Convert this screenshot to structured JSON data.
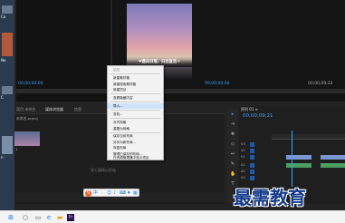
{
  "desktop": {
    "items": [
      {
        "label": "Ca"
      },
      {
        "label": "Ne"
      },
      {
        "label": "C"
      },
      {
        "label": "n"
      }
    ]
  },
  "source_monitor": {
    "timecode": "00;00;00;00"
  },
  "program_monitor": {
    "video_caption": "❤遇向日落，日出复活☀",
    "timecode": "00;00;00;00",
    "duration": "00;00;09;22"
  },
  "project_panel": {
    "tabs": [
      {
        "label": "项目 未命名"
      },
      {
        "label": "媒体浏览器"
      },
      {
        "label": "信息"
      }
    ],
    "search_row": "未命名.prproj",
    "thumb_label": "1",
    "import_hint": "导入媒体以开始"
  },
  "timeline": {
    "title": "序列 01 ≡",
    "timecode": "00;00;09;21",
    "tracks": [
      {
        "label": "V3"
      },
      {
        "label": "V2"
      },
      {
        "label": "V1"
      },
      {
        "label": "A1"
      },
      {
        "label": "A2"
      },
      {
        "label": "A3"
      }
    ],
    "clip_label": "fx 01.mp4"
  },
  "context_menu": {
    "items": [
      {
        "label": "粘贴",
        "disabled": true
      },
      {
        "label": "新建素材箱"
      },
      {
        "label": "新建搜索素材箱"
      },
      {
        "label": "新建项目"
      },
      {
        "label": "查看隐藏内容"
      },
      {
        "label": "导入...",
        "highlighted": true
      },
      {
        "label": "查找..."
      },
      {
        "label": "对齐网格"
      },
      {
        "label": "重置为网格"
      },
      {
        "label": "保存当前布局"
      },
      {
        "label": "另存为新布局..."
      },
      {
        "label": "恢复布局"
      },
      {
        "label": "管理已保存的布局..."
      },
      {
        "label": "在资源管理器中显示项目"
      }
    ]
  },
  "watermark": "最需教育",
  "colors": {
    "accent": "#3aa0ff",
    "highlight": "#cfe2f9",
    "watermark": "#123a8a"
  }
}
